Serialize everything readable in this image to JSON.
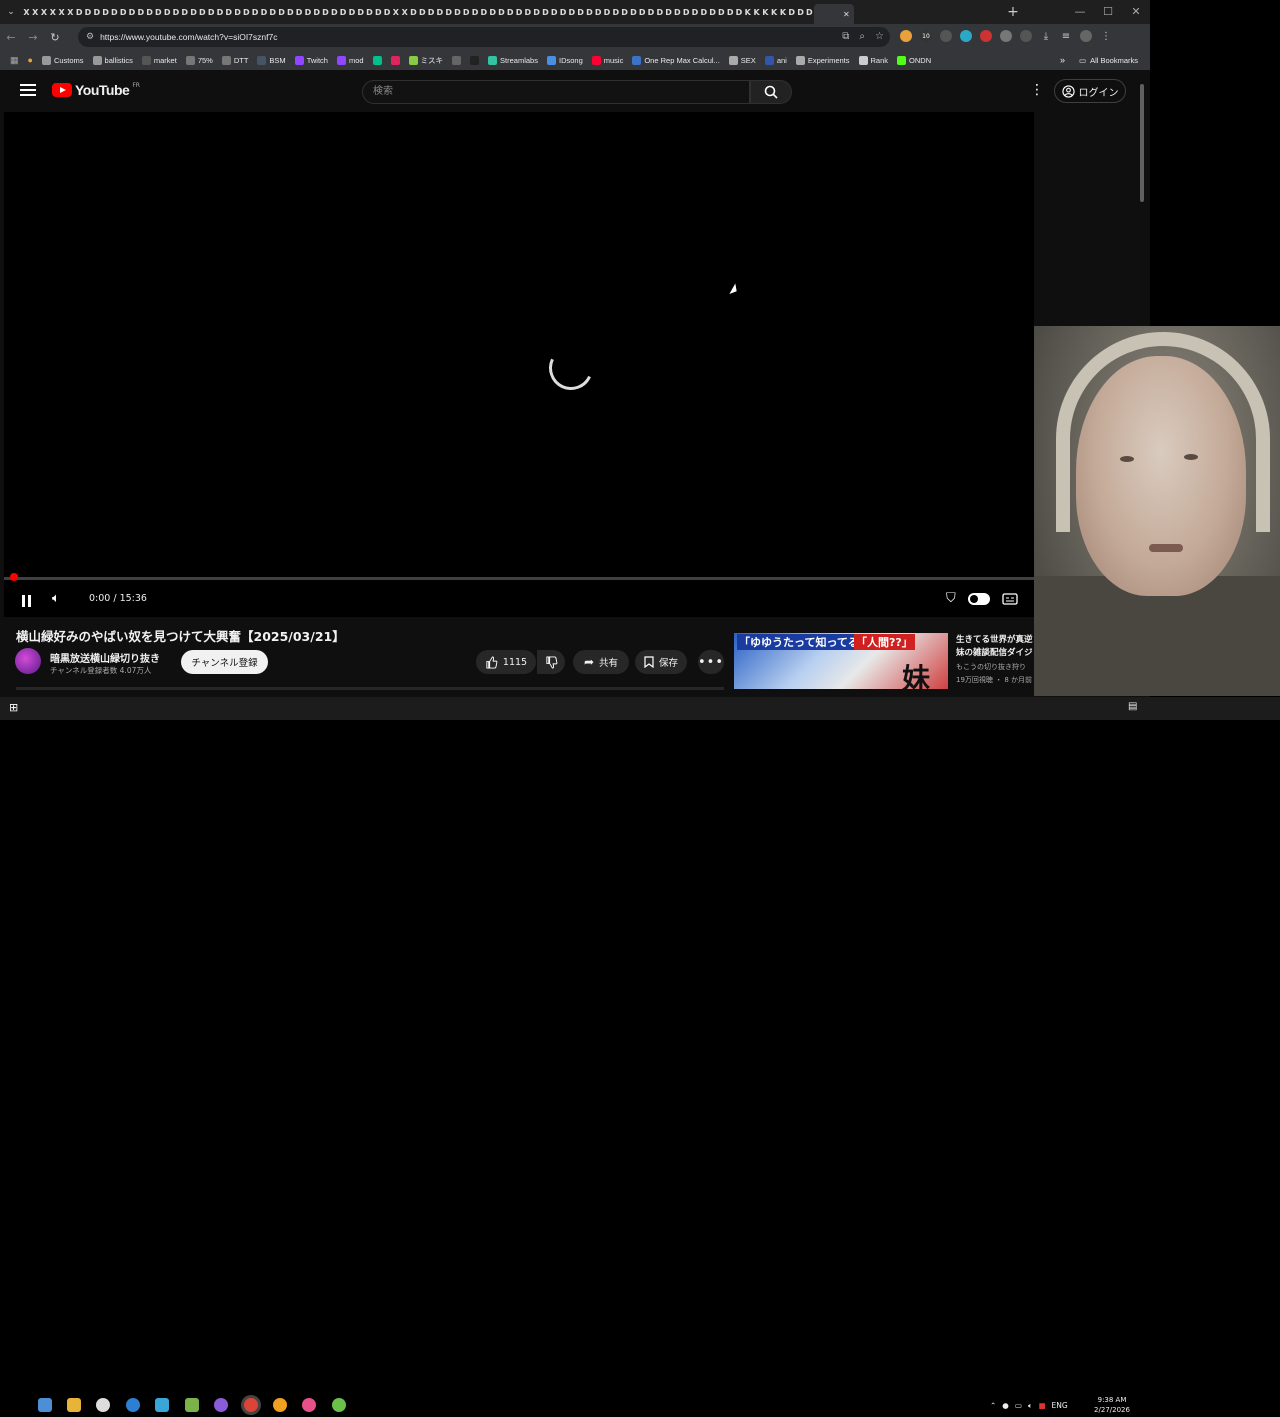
{
  "browser": {
    "url": "https://www.youtube.com/watch?v=siOI7sznf7c",
    "tab_glyphs": [
      "X",
      "X",
      "X",
      "X",
      "X",
      "X",
      "D",
      "D",
      "D",
      "D",
      "D",
      "D",
      "D",
      "D",
      "D",
      "D",
      "D",
      "D",
      "D",
      "D",
      "D",
      "D",
      "D",
      "D",
      "D",
      "D",
      "D",
      "D",
      "D",
      "D",
      "D",
      "D",
      "D",
      "D",
      "D",
      "D",
      "D",
      "D",
      "D",
      "D",
      "D",
      "D",
      "X",
      "X",
      "D",
      "D",
      "D",
      "D",
      "D",
      "D",
      "D",
      "D",
      "D",
      "D",
      "D",
      "D",
      "D",
      "D",
      "D",
      "D",
      "D",
      "D",
      "D",
      "D",
      "D",
      "D",
      "D",
      "D",
      "D",
      "D",
      "D",
      "D",
      "D",
      "D",
      "D",
      "D",
      "D",
      "D",
      "D",
      "D",
      "D",
      "D",
      "K",
      "K",
      "K",
      "K",
      "K",
      "D",
      "D",
      "D"
    ],
    "new_tab": "+",
    "bookmarks": [
      {
        "label": "Customs",
        "icon": "file-icon",
        "color": "#999999"
      },
      {
        "label": "ballistics",
        "icon": "globe-icon",
        "color": "#999999"
      },
      {
        "label": "market",
        "icon": "tm-icon",
        "color": "#555555"
      },
      {
        "label": "75%",
        "icon": "dash-icon",
        "color": "#777777"
      },
      {
        "label": "DTT",
        "icon": "dash-icon",
        "color": "#777777"
      },
      {
        "label": "BSM",
        "icon": "steam-icon",
        "color": "#445566"
      },
      {
        "label": "Twitch",
        "icon": "twitch-icon",
        "color": "#9146ff"
      },
      {
        "label": "mod",
        "icon": "twitch-icon",
        "color": "#9146ff"
      },
      {
        "label": "",
        "icon": "tt-icon",
        "color": "#00c08b"
      },
      {
        "label": "",
        "icon": "red-dot-icon",
        "color": "#e0245e"
      },
      {
        "label": "ミスキ",
        "icon": "misskey-icon",
        "color": "#88cc44"
      },
      {
        "label": "",
        "icon": "arrow-icon",
        "color": "#666666"
      },
      {
        "label": "",
        "icon": "x-icon",
        "color": "#222222"
      },
      {
        "label": "Streamlabs",
        "icon": "streamlabs-icon",
        "color": "#31c3a2"
      },
      {
        "label": "IDsong",
        "icon": "idsong-icon",
        "color": "#4a90e2"
      },
      {
        "label": "music",
        "icon": "music-icon",
        "color": "#ff0033"
      },
      {
        "label": "One Rep Max Calcul...",
        "icon": "calc-icon",
        "color": "#3b73c7"
      },
      {
        "label": "SEX",
        "icon": "folder-icon",
        "color": "#aaaaaa"
      },
      {
        "label": "ani",
        "icon": "a-icon",
        "color": "#3355aa"
      },
      {
        "label": "Experiments",
        "icon": "flask-icon",
        "color": "#aaaaaa"
      },
      {
        "label": "Rank",
        "icon": "cloud-icon",
        "color": "#cccccc"
      },
      {
        "label": "ONDN",
        "icon": "k-icon",
        "color": "#53fc18"
      }
    ],
    "all_bookmarks": "All Bookmarks"
  },
  "youtube": {
    "logo_text": "YouTube",
    "region": "FR",
    "search_placeholder": "検索",
    "login_label": "ログイン",
    "time": "0:00 / 15:36",
    "progress_fraction": 0.0,
    "video": {
      "title": "横山緑好みのやばい奴を見つけて大興奮【2025/03/21】",
      "channel_name": "暗黒放送横山緑切り抜き",
      "subscribers": "チャンネル登録者数 4.07万人",
      "subscribe_label": "チャンネル登録",
      "likes": "1115",
      "share_label": "共有",
      "save_label": "保存"
    },
    "recommendation": {
      "thumb_text_1": "「ゆゆうたって知ってる?」",
      "thumb_text_2": "「人間??」",
      "thumb_big": "妹",
      "title_line_1": "生きてる世界が真逆",
      "title_line_2": "妹の雑談配信ダイジ",
      "channel": "もこうの切り抜き狩り",
      "meta": "19万回視聴 ・ 8 か月前"
    }
  },
  "taskbar": {
    "lang": "ENG",
    "time": "9:38 AM",
    "date": "2/27/2026"
  }
}
